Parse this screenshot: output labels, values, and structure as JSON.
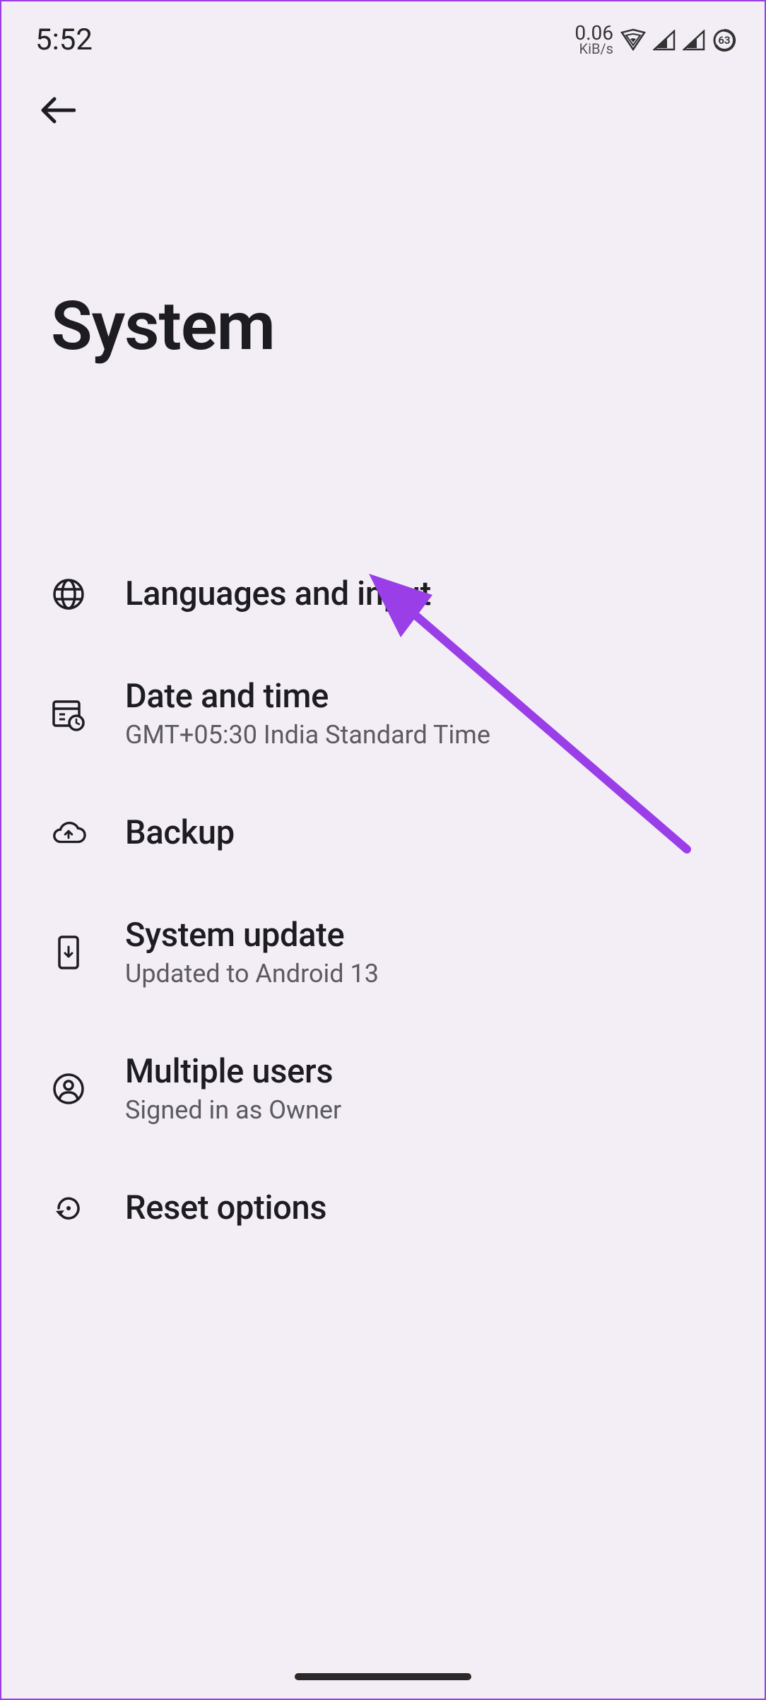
{
  "status_bar": {
    "time": "5:52",
    "net_speed_value": "0.06",
    "net_speed_unit": "KiB/s",
    "battery_pct": "63"
  },
  "page": {
    "title": "System"
  },
  "items": [
    {
      "title": "Languages and input",
      "subtitle": ""
    },
    {
      "title": "Date and time",
      "subtitle": "GMT+05:30 India Standard Time"
    },
    {
      "title": "Backup",
      "subtitle": ""
    },
    {
      "title": "System update",
      "subtitle": "Updated to Android 13"
    },
    {
      "title": "Multiple users",
      "subtitle": "Signed in as Owner"
    },
    {
      "title": "Reset options",
      "subtitle": ""
    }
  ]
}
